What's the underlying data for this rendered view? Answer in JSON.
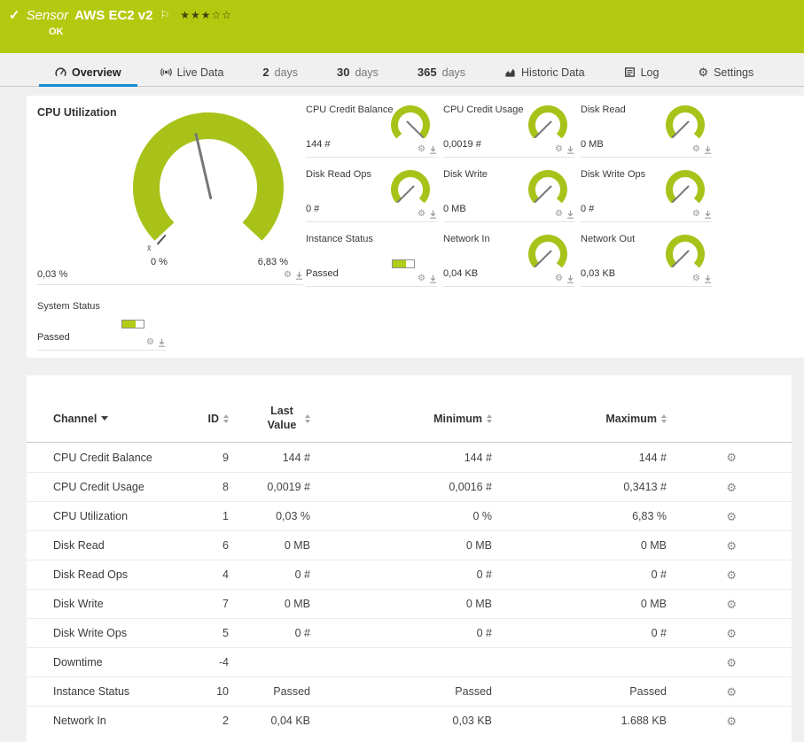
{
  "icons": {
    "check": "✓",
    "flag": "⚐",
    "gear": "⚙",
    "star_filled": "★",
    "star_empty": "☆"
  },
  "colors": {
    "header_green": "#b3c90f",
    "gauge_green": "#a9c21a",
    "accent_blue": "#1a8ad2"
  },
  "header": {
    "kind_label": "Sensor",
    "title": "AWS EC2 v2",
    "status": "OK",
    "rating": {
      "filled": 3,
      "total": 5
    }
  },
  "tabs": [
    {
      "label": "Overview",
      "icon": "overview",
      "active": true
    },
    {
      "label": "Live Data",
      "icon": "live"
    },
    {
      "num": "2",
      "label": "days"
    },
    {
      "num": "30",
      "label": "days"
    },
    {
      "num": "365",
      "label": "days"
    },
    {
      "label": "Historic Data",
      "icon": "historic"
    },
    {
      "label": "Log",
      "icon": "log"
    },
    {
      "label": "Settings",
      "icon": "settings"
    }
  ],
  "main_gauge": {
    "title": "CPU Utilization",
    "value": "0,03 %",
    "min": "0 %",
    "max": "6,83 %",
    "avg_marker": "x̄",
    "needle_deg": 103
  },
  "small_gauges": [
    {
      "title": "CPU Credit Balance",
      "value": "144 #",
      "type": "gauge",
      "needle_deg": -45
    },
    {
      "title": "CPU Credit Usage",
      "value": "0,0019 #",
      "type": "gauge",
      "needle_deg": 225
    },
    {
      "title": "Disk Read",
      "value": "0 MB",
      "type": "gauge",
      "needle_deg": 225
    },
    {
      "title": "Disk Read Ops",
      "value": "0 #",
      "type": "gauge",
      "needle_deg": 225
    },
    {
      "title": "Disk Write",
      "value": "0 MB",
      "type": "gauge",
      "needle_deg": 225
    },
    {
      "title": "Disk Write Ops",
      "value": "0 #",
      "type": "gauge",
      "needle_deg": 225
    },
    {
      "title": "Instance Status",
      "value": "Passed",
      "type": "bar",
      "bar_fill": 0.62
    },
    {
      "title": "Network In",
      "value": "0,04 KB",
      "type": "gauge",
      "needle_deg": 225
    },
    {
      "title": "Network Out",
      "value": "0,03 KB",
      "type": "gauge",
      "needle_deg": 225
    }
  ],
  "system_status": {
    "title": "System Status",
    "value": "Passed",
    "type": "bar",
    "bar_fill": 0.62
  },
  "table": {
    "columns": [
      {
        "label": "Channel",
        "sort": "desc"
      },
      {
        "label": "ID",
        "sort": "both"
      },
      {
        "label": "Last Value",
        "sort": "both"
      },
      {
        "label": "Minimum",
        "sort": "both"
      },
      {
        "label": "Maximum",
        "sort": "both"
      }
    ],
    "rows": [
      {
        "channel": "CPU Credit Balance",
        "id": "9",
        "last": "144 #",
        "min": "144 #",
        "max": "144 #"
      },
      {
        "channel": "CPU Credit Usage",
        "id": "8",
        "last": "0,0019 #",
        "min": "0,0016 #",
        "max": "0,3413 #"
      },
      {
        "channel": "CPU Utilization",
        "id": "1",
        "last": "0,03 %",
        "min": "0 %",
        "max": "6,83 %"
      },
      {
        "channel": "Disk Read",
        "id": "6",
        "last": "0 MB",
        "min": "0 MB",
        "max": "0 MB"
      },
      {
        "channel": "Disk Read Ops",
        "id": "4",
        "last": "0 #",
        "min": "0 #",
        "max": "0 #"
      },
      {
        "channel": "Disk Write",
        "id": "7",
        "last": "0 MB",
        "min": "0 MB",
        "max": "0 MB"
      },
      {
        "channel": "Disk Write Ops",
        "id": "5",
        "last": "0 #",
        "min": "0 #",
        "max": "0 #"
      },
      {
        "channel": "Downtime",
        "id": "-4",
        "last": "",
        "min": "",
        "max": ""
      },
      {
        "channel": "Instance Status",
        "id": "10",
        "last": "Passed",
        "min": "Passed",
        "max": "Passed"
      },
      {
        "channel": "Network In",
        "id": "2",
        "last": "0,04 KB",
        "min": "0,03 KB",
        "max": "1.688 KB"
      }
    ]
  }
}
